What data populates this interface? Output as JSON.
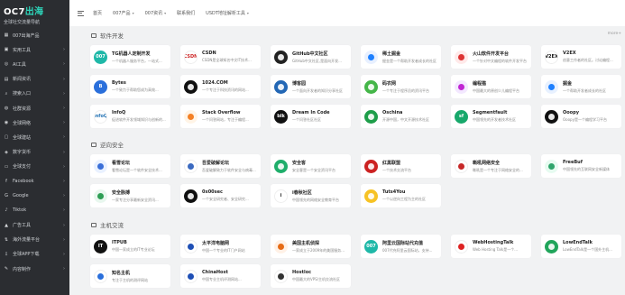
{
  "brand": {
    "name_part1": "OC7",
    "name_part2": "出海",
    "tagline": "全球社交流量导航"
  },
  "sidebar": {
    "items": [
      {
        "label": "007出海产品",
        "icon": "grid-icon",
        "chevron": false
      },
      {
        "label": "实用工具",
        "icon": "toolbox-icon",
        "chevron": true
      },
      {
        "label": "AI工具",
        "icon": "ai-icon",
        "chevron": true
      },
      {
        "label": "新闻资讯",
        "icon": "news-icon",
        "chevron": true
      },
      {
        "label": "搜索入口",
        "icon": "search-icon",
        "chevron": true
      },
      {
        "label": "社群资源",
        "icon": "community-icon",
        "chevron": true
      },
      {
        "label": "全球网络",
        "icon": "globe-icon",
        "chevron": true
      },
      {
        "label": "全球建站",
        "icon": "site-icon",
        "chevron": true
      },
      {
        "label": "数字货币",
        "icon": "coin-icon",
        "chevron": true
      },
      {
        "label": "全球支付",
        "icon": "payment-icon",
        "chevron": true
      },
      {
        "label": "Facebook",
        "icon": "facebook-icon",
        "chevron": true
      },
      {
        "label": "Google",
        "icon": "google-icon",
        "chevron": true
      },
      {
        "label": "Tiktok",
        "icon": "tiktok-icon",
        "chevron": true
      },
      {
        "label": "广告工具",
        "icon": "ad-icon",
        "chevron": true
      },
      {
        "label": "海外流量平台",
        "icon": "traffic-icon",
        "chevron": true
      },
      {
        "label": "全球APP下载",
        "icon": "download-icon",
        "chevron": true
      },
      {
        "label": "内容制作",
        "icon": "content-icon",
        "chevron": true
      }
    ]
  },
  "topnav": {
    "items": [
      {
        "label": "首页",
        "caret": false
      },
      {
        "label": "007产品",
        "caret": true
      },
      {
        "label": "007资讯",
        "caret": true
      },
      {
        "label": "联系我们",
        "caret": false
      },
      {
        "label": "USDT地址解析工具",
        "caret": true
      }
    ]
  },
  "sections": [
    {
      "title": "软件开发",
      "more": "more+",
      "cards": [
        {
          "title": "TG机器人定制开发",
          "desc": "一个机器人服务平台，一站式...",
          "icon_text": "007",
          "icon_color": "#1fb8a8"
        },
        {
          "title": "CSDN",
          "desc": "CSDN是全球知名中文IT技术...",
          "icon_text": "CSDN",
          "icon_color": "#ffffff",
          "icon_fg": "#c22"
        },
        {
          "title": "GitHub中文社区",
          "desc": "GitHub中文社区,是面向开发...",
          "icon_text": "",
          "icon_color": "#222222"
        },
        {
          "title": "稀土掘金",
          "desc": "掘金是一个帮助开发者成长的社区",
          "icon_text": "",
          "icon_color": "#e8f0ff",
          "icon_fg": "#1e80ff"
        },
        {
          "title": "火山软件开发平台",
          "desc": "一个针对中文编程的软件开发平台",
          "icon_text": "",
          "icon_color": "#ffe9e9",
          "icon_fg": "#d33"
        },
        {
          "title": "V2EX",
          "desc": "创意工作者的社区。讨论编程...",
          "icon_text": "V2EX",
          "icon_color": "#ffffff",
          "icon_fg": "#111"
        },
        {
          "title": "Bytes",
          "desc": "一个致力于帮助您成为高效...",
          "icon_text": "B",
          "icon_color": "#2a6fdb"
        },
        {
          "title": "1024.COM",
          "desc": "一个专注于科技资讯的网站...",
          "icon_text": "",
          "icon_color": "#111111"
        },
        {
          "title": "博客园",
          "desc": "一个面向开发者的知识分享社区",
          "icon_text": "",
          "icon_color": "#2367b5"
        },
        {
          "title": "码农网",
          "desc": "一个专注于程序员的资讯平台",
          "icon_text": "",
          "icon_color": "#45b649"
        },
        {
          "title": "编程猫",
          "desc": "中国最大的原创少儿编程平台",
          "icon_text": "",
          "icon_color": "#f3e8ff",
          "icon_fg": "#c026d3"
        },
        {
          "title": "掘金",
          "desc": "一个帮助开发者成长的社区",
          "icon_text": "",
          "icon_color": "#e8f1ff",
          "icon_fg": "#1e80ff"
        },
        {
          "title": "InfoQ",
          "desc": "促进软件开发领域知识与创新的...",
          "icon_text": "InfoQ",
          "icon_color": "#ffffff",
          "icon_fg": "#1f6fb2"
        },
        {
          "title": "Stack Overflow",
          "desc": "一个问答网站，专注于编程...",
          "icon_text": "",
          "icon_color": "#fff4e6",
          "icon_fg": "#f48024"
        },
        {
          "title": "Dream In Code",
          "desc": "一个问答社区社区",
          "icon_text": "blk",
          "icon_color": "#111111"
        },
        {
          "title": "Oschina",
          "desc": "开源中国，中文开源技术社区",
          "icon_text": "",
          "icon_color": "#1e9e4a"
        },
        {
          "title": "Segmentfault",
          "desc": "中国领先的开发者技术社区",
          "icon_text": "sf",
          "icon_color": "#17a86b"
        },
        {
          "title": "Ooopy",
          "desc": "Ooopy是一个编程学习平台",
          "icon_text": "",
          "icon_color": "#111111"
        }
      ]
    },
    {
      "title": "逆向安全",
      "more": "",
      "cards": [
        {
          "title": "看雪论坛",
          "desc": "看雪论坛是一个软件安全技术...",
          "icon_text": "",
          "icon_color": "#e9f1ff",
          "icon_fg": "#3a6fd8"
        },
        {
          "title": "吾爱破解论坛",
          "desc": "吾爱破解致力于软件安全与病毒...",
          "icon_text": "",
          "icon_color": "#ffffff",
          "icon_fg": "#3b6ac0"
        },
        {
          "title": "安全客",
          "desc": "安全客是一个安全资讯平台",
          "icon_text": "",
          "icon_color": "#1fae6b"
        },
        {
          "title": "红黑联盟",
          "desc": "一个技术交流平台",
          "icon_text": "",
          "icon_color": "#cc2222"
        },
        {
          "title": "嘶吼网络安全",
          "desc": "嘶吼是一个专注于网络安全的...",
          "icon_text": "",
          "icon_color": "#ffffff",
          "icon_fg": "#c62828"
        },
        {
          "title": "FreeBuf",
          "desc": "中国领先的互联网安全新媒体",
          "icon_text": "",
          "icon_color": "#e6fbf0",
          "icon_fg": "#2ea56b"
        },
        {
          "title": "安全脉搏",
          "desc": "一家专注分享最新安全资讯...",
          "icon_text": "",
          "icon_color": "#e8f7ee",
          "icon_fg": "#2e9e55"
        },
        {
          "title": "0x00sec",
          "desc": "一个安全研究者、安全研究...",
          "icon_text": "",
          "icon_color": "#111111"
        },
        {
          "title": "i春秋社区",
          "desc": "中国领先的网络安全教育平台",
          "icon_text": "i",
          "icon_color": "#ffffff",
          "icon_fg": "#222"
        },
        {
          "title": "Tuts4You",
          "desc": "一个以逆向工程为主的社区",
          "icon_text": "",
          "icon_color": "#f7c325"
        }
      ]
    },
    {
      "title": "主机交流",
      "more": "",
      "cards": [
        {
          "title": "ITPUB",
          "desc": "中国一家成立的IT专业论坛",
          "icon_text": "IT",
          "icon_color": "#111111"
        },
        {
          "title": "太平洋电脑网",
          "desc": "中国一个专业的IT门户网站",
          "icon_text": "",
          "icon_color": "#ffffff",
          "icon_fg": "#1e4fb5"
        },
        {
          "title": "美国主机侦探",
          "desc": "一家成立于2009年的美国服务...",
          "icon_text": "",
          "icon_color": "#fff1e6",
          "icon_fg": "#e66b15"
        },
        {
          "title": "阿里云国际站代充值",
          "desc": "007代充阿里云国际站，支持...",
          "icon_text": "007",
          "icon_color": "#1fb8a8"
        },
        {
          "title": "WebHostingTalk",
          "desc": "Web Hosting Talk是一个...",
          "icon_text": "",
          "icon_color": "#ffffff",
          "icon_fg": "#d22"
        },
        {
          "title": "LowEndTalk",
          "desc": "LowEndTalk是一个国外主机...",
          "icon_text": "",
          "icon_color": "#21a55b"
        },
        {
          "title": "知名主机",
          "desc": "专注于主机的测评网站",
          "icon_text": "",
          "icon_color": "#ffffff",
          "icon_fg": "#2a6fdb"
        },
        {
          "title": "ChinaHost",
          "desc": "中国专业主机评测网站...",
          "icon_text": "",
          "icon_color": "#ffffff",
          "icon_fg": "#1e4fb5"
        },
        {
          "title": "Hostloc",
          "desc": "中国最大的VPS/主机交流社区",
          "icon_text": "",
          "icon_color": "#ffffff",
          "icon_fg": "#333"
        }
      ]
    }
  ]
}
